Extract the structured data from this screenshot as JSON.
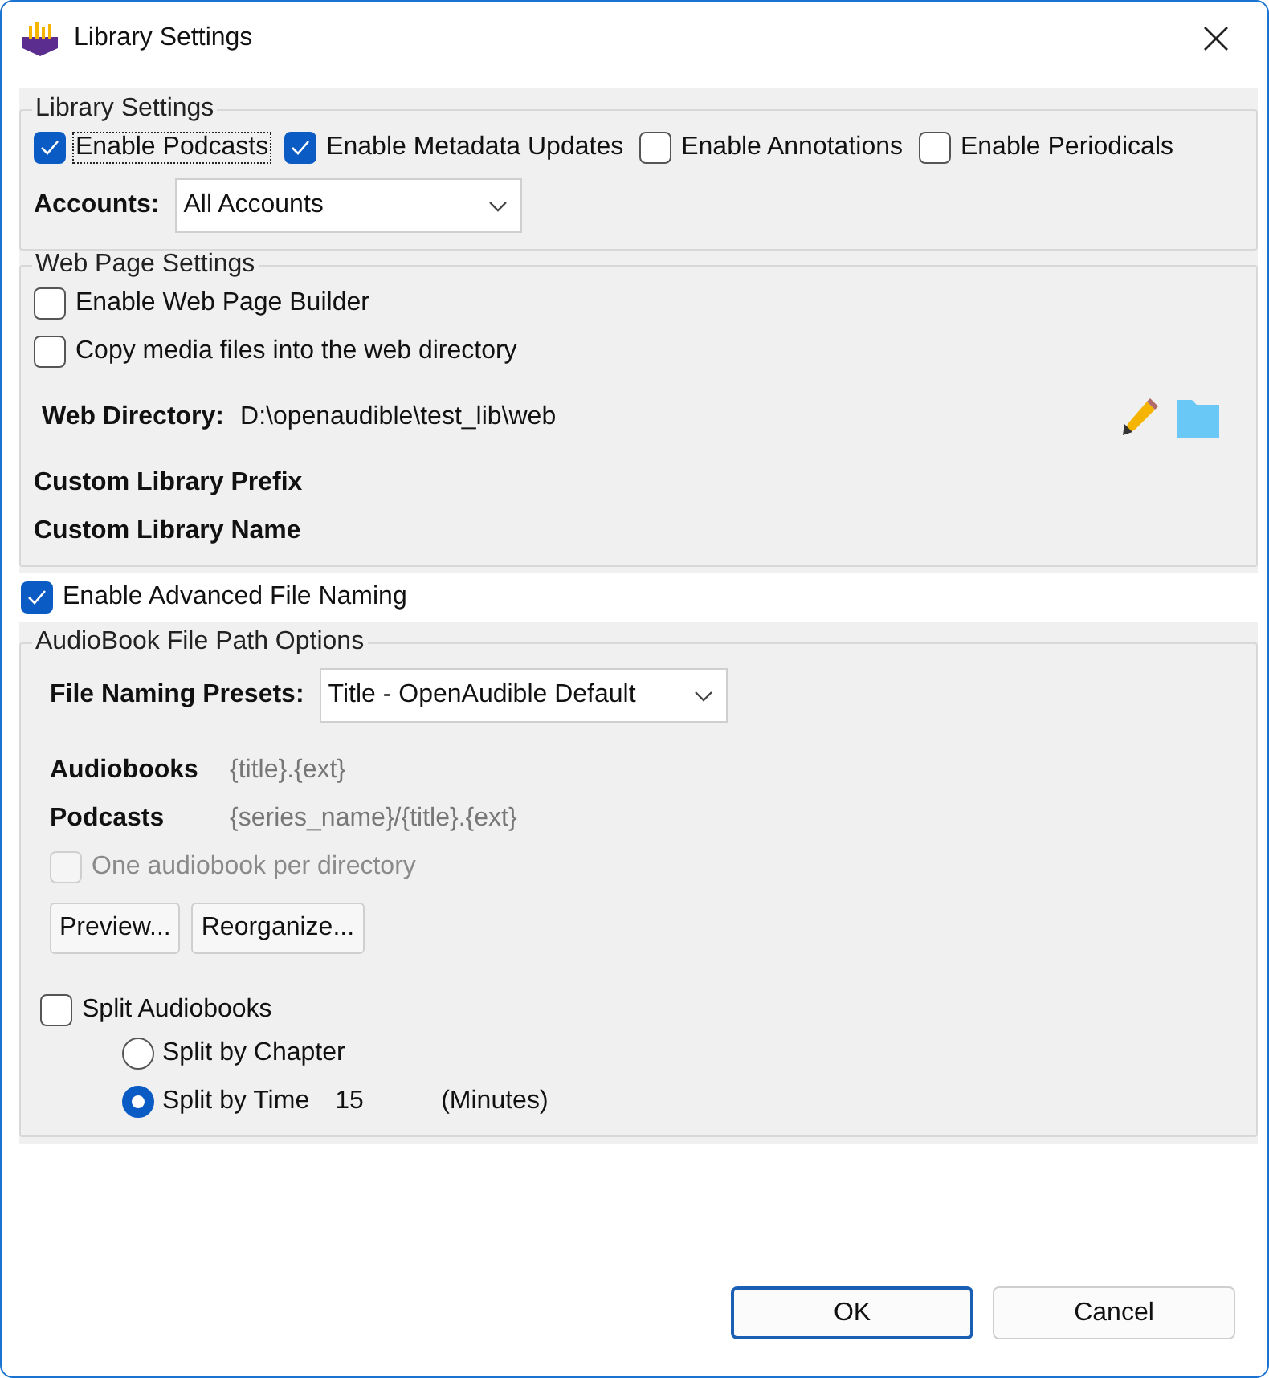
{
  "window": {
    "title": "Library Settings"
  },
  "library_settings": {
    "legend": "Library Settings",
    "options": [
      {
        "label": "Enable Podcasts",
        "checked": true,
        "focused": true
      },
      {
        "label": "Enable Metadata Updates",
        "checked": true,
        "focused": false
      },
      {
        "label": "Enable Annotations",
        "checked": false,
        "focused": false
      },
      {
        "label": "Enable Periodicals",
        "checked": false,
        "focused": false
      }
    ],
    "accounts": {
      "label": "Accounts:",
      "value": "All Accounts"
    }
  },
  "web_page_settings": {
    "legend": "Web Page Settings",
    "options": [
      {
        "label": "Enable Web Page Builder",
        "checked": false
      },
      {
        "label": "Copy media files into the web directory",
        "checked": false
      }
    ],
    "web_directory": {
      "label": "Web Directory:",
      "value": "D:\\openaudible\\test_lib\\web"
    },
    "custom_fields": [
      "Custom Library Prefix",
      "Custom Library Name"
    ]
  },
  "advanced_naming": {
    "label": "Enable Advanced File Naming",
    "checked": true
  },
  "file_path_options": {
    "legend": "AudioBook File Path Options",
    "presets": {
      "label": "File Naming Presets:",
      "value": "Title - OpenAudible Default"
    },
    "patterns": [
      {
        "label": "Audiobooks",
        "value": "{title}.{ext}"
      },
      {
        "label": "Podcasts",
        "value": "{series_name}/{title}.{ext}"
      }
    ],
    "one_per_directory": {
      "label": "One audiobook per directory",
      "checked": false,
      "disabled": true
    },
    "buttons": [
      "Preview...",
      "Reorganize..."
    ],
    "split": {
      "label": "Split Audiobooks",
      "checked": false
    },
    "split_modes": [
      {
        "label": "Split by Chapter",
        "selected": false
      },
      {
        "label": "Split by Time",
        "selected": true,
        "value": "15",
        "unit": "(Minutes)"
      }
    ]
  },
  "buttons": [
    {
      "label": "OK",
      "default": true
    },
    {
      "label": "Cancel",
      "default": false
    }
  ]
}
